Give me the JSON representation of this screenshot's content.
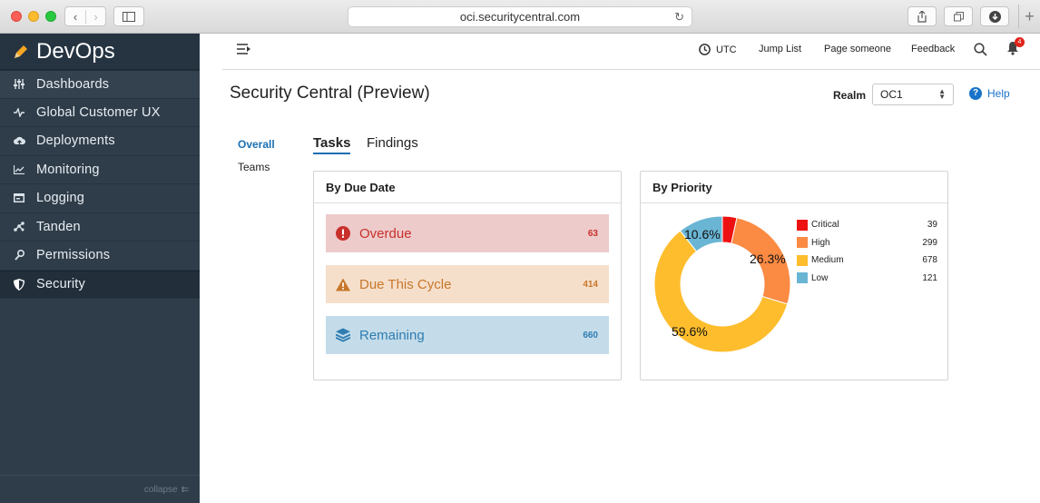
{
  "browser": {
    "url": "oci.securitycentral.com"
  },
  "sidebar": {
    "brand": "DevOps",
    "items": [
      {
        "label": "Dashboards",
        "icon": "sliders-icon"
      },
      {
        "label": "Global Customer UX",
        "icon": "pulse-icon"
      },
      {
        "label": "Deployments",
        "icon": "cloud-upload-icon"
      },
      {
        "label": "Monitoring",
        "icon": "line-chart-icon"
      },
      {
        "label": "Logging",
        "icon": "terminal-icon"
      },
      {
        "label": "Tanden",
        "icon": "network-icon"
      },
      {
        "label": "Permissions",
        "icon": "key-icon"
      },
      {
        "label": "Security",
        "icon": "shield-icon"
      }
    ],
    "active": "Security",
    "collapse_label": "collapse"
  },
  "topbar": {
    "timezone": "UTC",
    "jump_list": "Jump List",
    "page_someone": "Page someone",
    "feedback": "Feedback",
    "notification_count": "4"
  },
  "page": {
    "title": "Security Central (Preview)",
    "realm_label": "Realm",
    "realm_value": "OC1",
    "help_label": "Help"
  },
  "subnav": {
    "overall": "Overall",
    "teams": "Teams"
  },
  "tabs": {
    "tasks": "Tasks",
    "findings": "Findings",
    "active": "Tasks"
  },
  "due_card": {
    "title": "By Due Date",
    "rows": [
      {
        "label": "Overdue",
        "count": "63",
        "icon": "alert-circle-icon",
        "color": "#c9302c"
      },
      {
        "label": "Due This Cycle",
        "count": "414",
        "icon": "warning-triangle-icon",
        "color": "#c8772a"
      },
      {
        "label": "Remaining",
        "count": "660",
        "icon": "layers-icon",
        "color": "#2f7db2"
      }
    ]
  },
  "priority_card": {
    "title": "By Priority",
    "slices": [
      {
        "label": "Critical",
        "value": "39",
        "color": "#ee1111"
      },
      {
        "label": "High",
        "value": "299",
        "color": "#fb8a43"
      },
      {
        "label": "Medium",
        "value": "678",
        "color": "#fdbd2d"
      },
      {
        "label": "Low",
        "value": "121",
        "color": "#6ab5d4"
      }
    ],
    "percent_labels": {
      "low": "10.6%",
      "high": "26.3%",
      "medium": "59.6%"
    }
  }
}
